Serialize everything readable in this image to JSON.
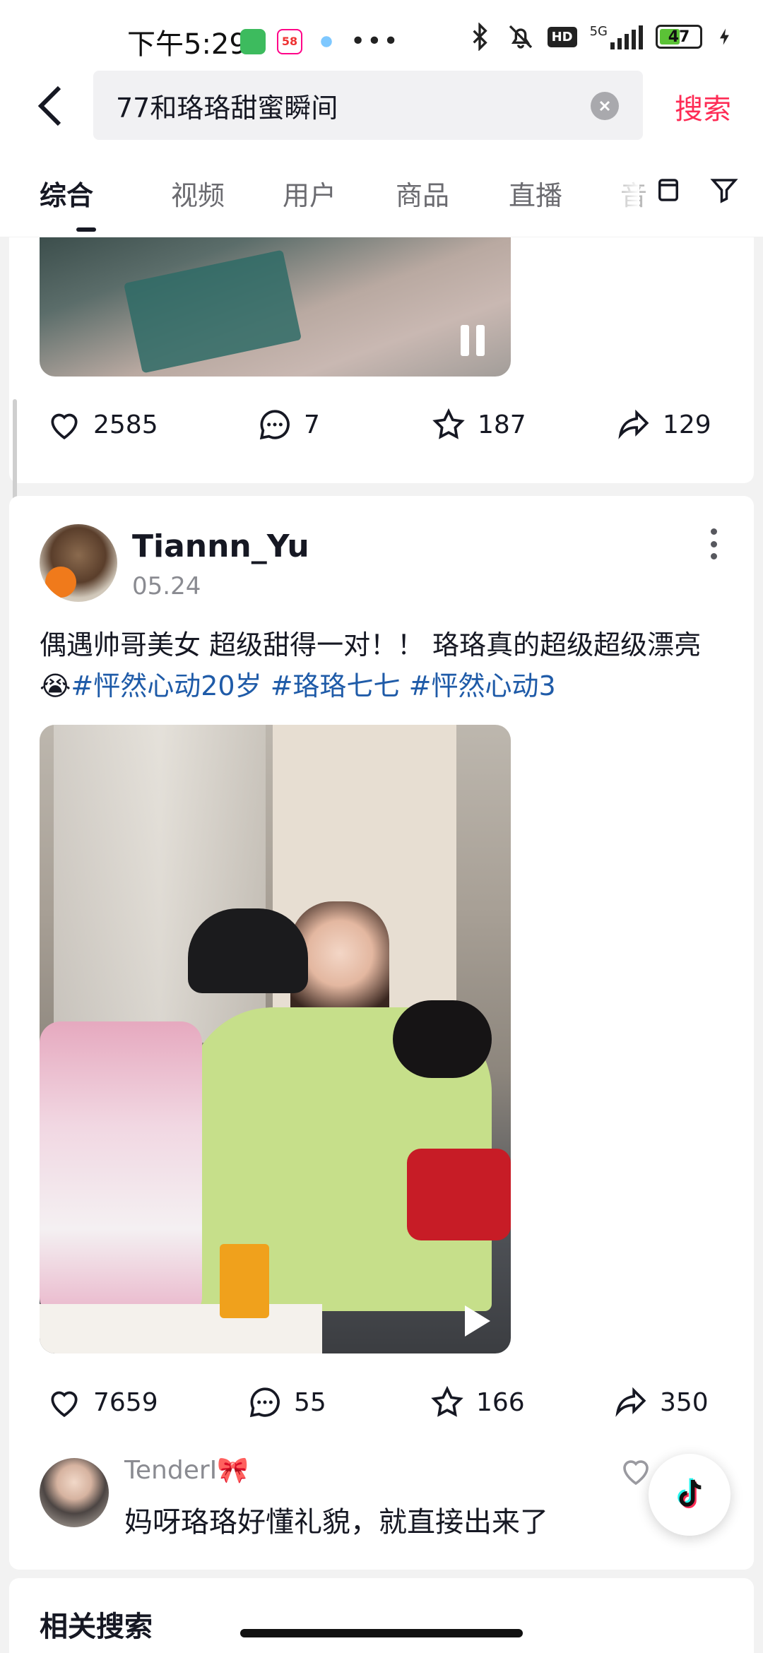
{
  "status_bar": {
    "time": "下午5:29",
    "battery_level": "47",
    "network": "5G",
    "app_badge": "58"
  },
  "search": {
    "query": "77和珞珞甜蜜瞬间",
    "search_button": "搜索"
  },
  "tabs": [
    {
      "label": "综合",
      "active": true
    },
    {
      "label": "视频",
      "active": false
    },
    {
      "label": "用户",
      "active": false
    },
    {
      "label": "商品",
      "active": false
    },
    {
      "label": "直播",
      "active": false
    },
    {
      "label": "音",
      "active": false
    }
  ],
  "post1": {
    "likes": "2585",
    "comments": "7",
    "favorites": "187",
    "shares": "129"
  },
  "post2": {
    "author": "Tiannn_Yu",
    "date": "05.24",
    "text": "偶遇帅哥美女 超级甜得一对！！ 珞珞真的超级超级漂亮😭",
    "hashtags": [
      "#怦然心动20岁",
      "#珞珞七七",
      "#怦然心动3"
    ],
    "likes": "7659",
    "comments": "55",
    "favorites": "166",
    "shares": "350",
    "top_comment": {
      "user": "TenderI🎀",
      "text": "妈呀珞珞好懂礼貌，就直接出来了"
    }
  },
  "related_search_title": "相关搜索",
  "colors": {
    "accent": "#fe2c55",
    "hashtag": "#1f5ba8",
    "text": "#161823",
    "secondary": "#8a8b91"
  }
}
